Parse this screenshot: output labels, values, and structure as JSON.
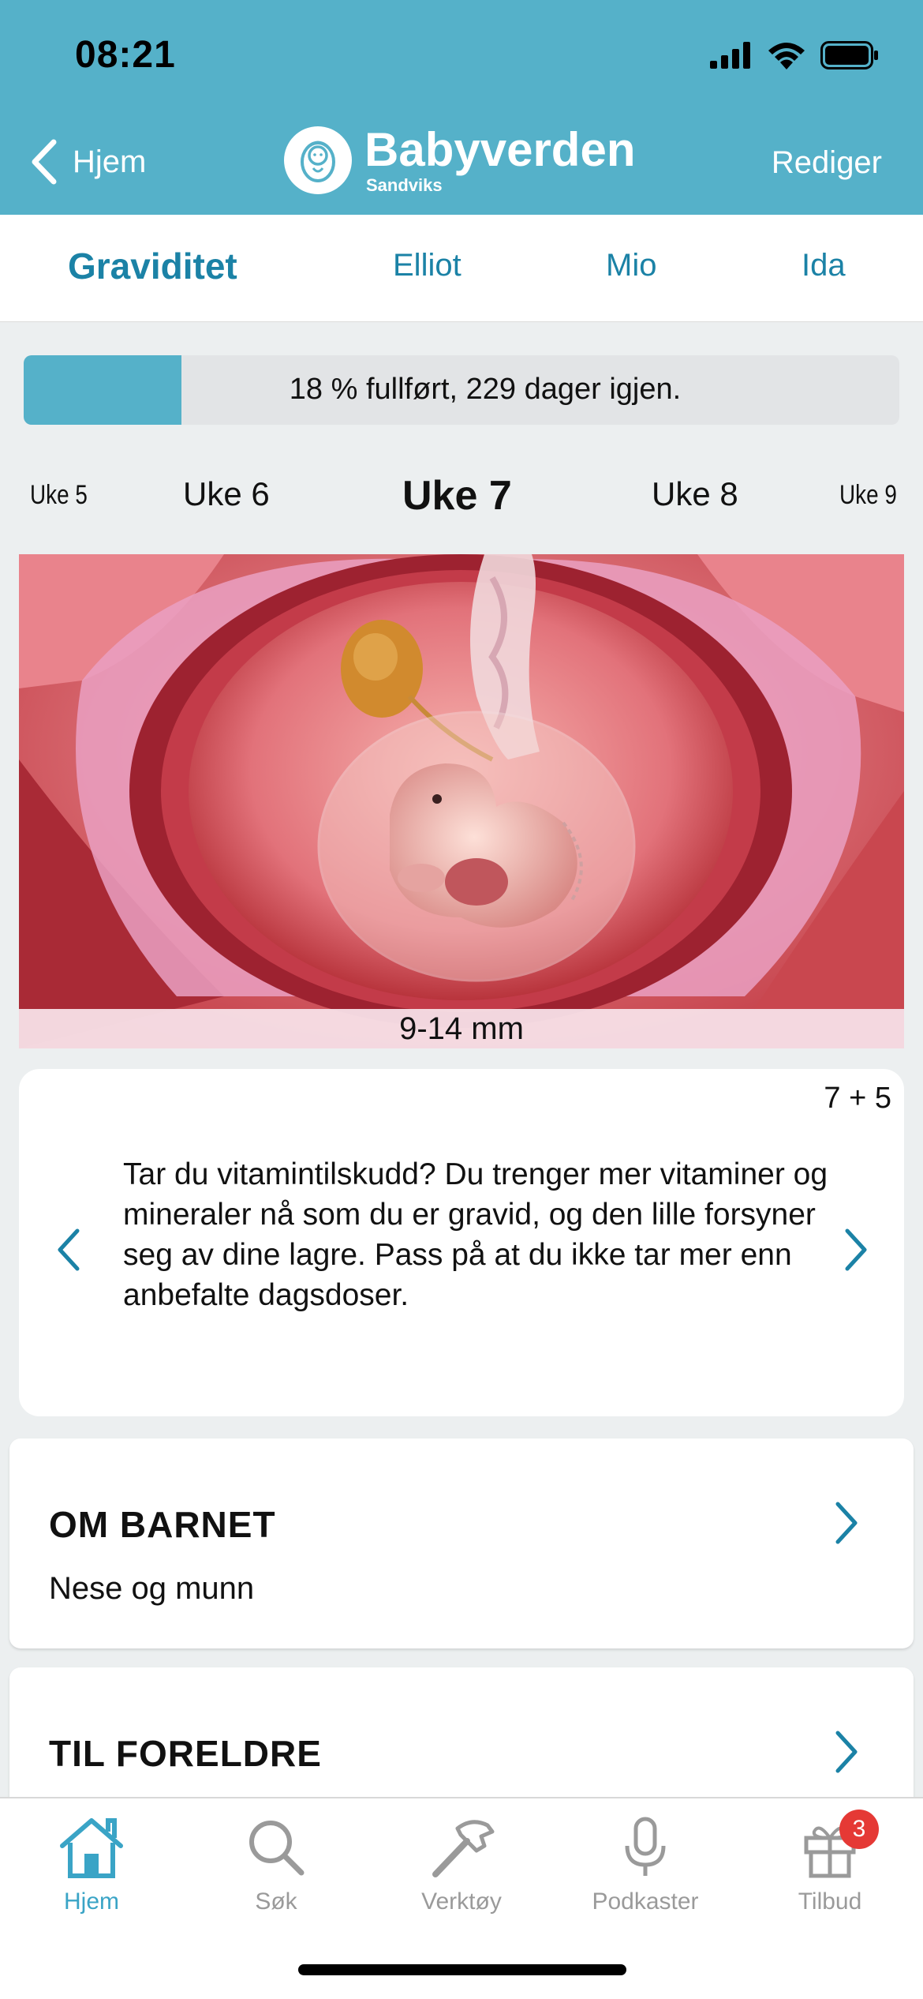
{
  "status_bar": {
    "time": "08:21"
  },
  "nav": {
    "back_label": "Hjem",
    "brand_name": "Babyverden",
    "brand_sub": "Sandviks",
    "right_label": "Rediger"
  },
  "tabs": [
    {
      "label": "Graviditet",
      "active": true
    },
    {
      "label": "Elliot",
      "active": false
    },
    {
      "label": "Mio",
      "active": false
    },
    {
      "label": "Ida",
      "active": false
    }
  ],
  "progress": {
    "percent_complete": 18,
    "text": "18 % fullført, 229 dager igjen."
  },
  "weeks": [
    {
      "label": "Uke 5"
    },
    {
      "label": "Uke 6"
    },
    {
      "label": "Uke 7",
      "current": true
    },
    {
      "label": "Uke 8"
    },
    {
      "label": "Uke 9"
    }
  ],
  "fetus_image": {
    "caption": "9-14 mm"
  },
  "tip": {
    "day": "7 + 5",
    "text": "Tar du vitamintilskudd? Du trenger mer vitaminer og mineraler nå som du er gravid, og den lille forsyner seg av dine lagre. Pass på at du ikke tar mer enn anbefalte dagsdoser."
  },
  "sections": [
    {
      "title": "OM BARNET",
      "subtitle": "Nese og munn"
    },
    {
      "title": "TIL FORELDRE",
      "subtitle": ""
    }
  ],
  "tabbar": [
    {
      "label": "Hjem",
      "icon": "home-icon",
      "active": true
    },
    {
      "label": "Søk",
      "icon": "search-icon",
      "active": false
    },
    {
      "label": "Verktøy",
      "icon": "hammer-icon",
      "active": false
    },
    {
      "label": "Podkaster",
      "icon": "microphone-icon",
      "active": false
    },
    {
      "label": "Tilbud",
      "icon": "gift-icon",
      "active": false,
      "badge": "3"
    }
  ],
  "colors": {
    "header": "#55b1c9",
    "accent_text": "#1b82a6",
    "badge": "#e53935"
  }
}
